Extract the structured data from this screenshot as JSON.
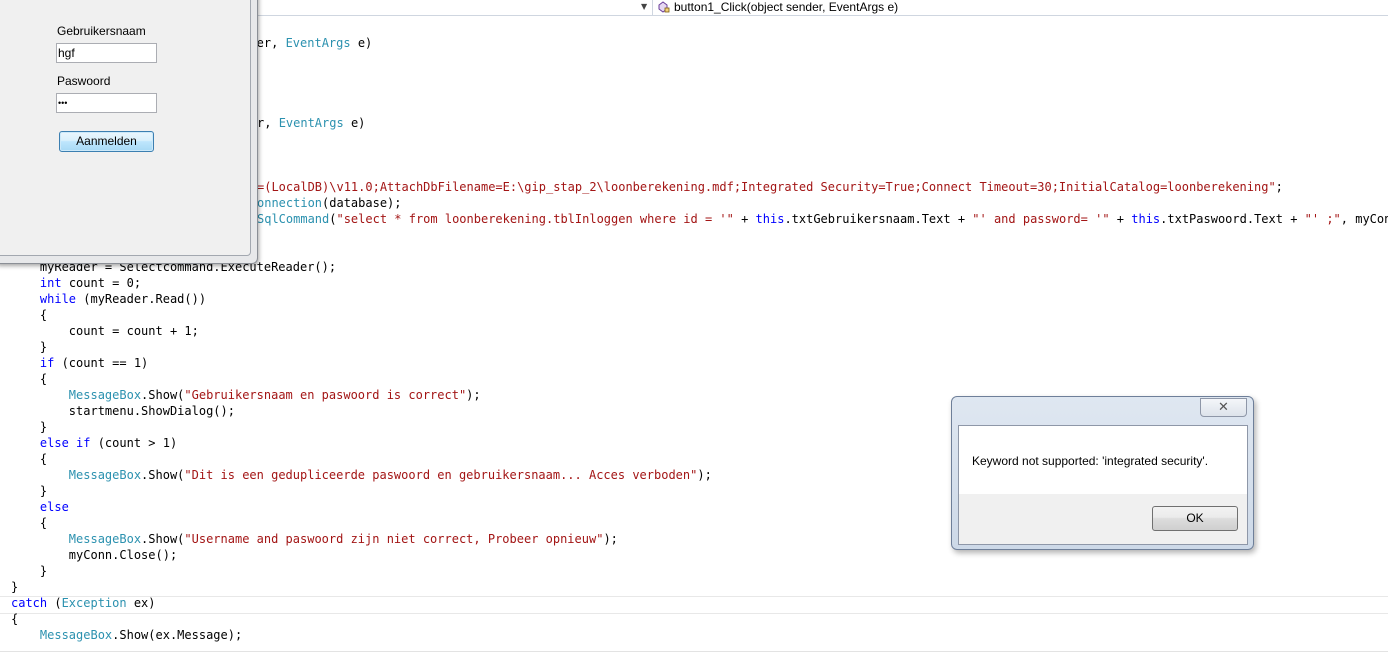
{
  "editor": {
    "member_dropdown": "button1_Click(object sender, EventArgs e)",
    "code_lines": [
      {
        "segments": [
          [
            "",
            "ender, "
          ],
          [
            "ty",
            "EventArgs"
          ],
          [
            "",
            " e)"
          ]
        ]
      },
      {
        "segments": [
          [
            "",
            "r, "
          ],
          [
            "ty",
            "EventArgs"
          ],
          [
            "",
            " e)"
          ]
        ]
      },
      {
        "segments": [
          [
            "st",
            "=(LocalDB)\\v11.0;AttachDbFilename=E:\\gip_stap_2\\loonberekening.mdf;Integrated Security=True;Connect Timeout=30;InitialCatalog=loonberekening\""
          ],
          [
            "",
            ";"
          ]
        ]
      },
      {
        "segments": [
          [
            "ty",
            "onnection"
          ],
          [
            "",
            "(database);"
          ]
        ]
      },
      {
        "segments": [
          [
            "ty",
            "SqlCommand"
          ],
          [
            "",
            "("
          ],
          [
            "st",
            "\"select * from loonberekening.tblInloggen where id = '\""
          ],
          [
            "",
            " + "
          ],
          [
            "kw",
            "this"
          ],
          [
            "",
            ".txtGebruikersnaam.Text + "
          ],
          [
            "st",
            "\"' and password= '\""
          ],
          [
            "",
            " + "
          ],
          [
            "kw",
            "this"
          ],
          [
            "",
            ".txtPaswoord.Text + "
          ],
          [
            "st",
            "\"' ;\""
          ],
          [
            "",
            ", myConn);"
          ]
        ]
      },
      {
        "segments": [
          [
            "",
            "    myReader = Selectcommand.ExecuteReader();"
          ]
        ]
      },
      {
        "segments": [
          [
            "",
            "    "
          ],
          [
            "kw",
            "int"
          ],
          [
            "",
            " count = 0;"
          ]
        ]
      },
      {
        "segments": [
          [
            "",
            "    "
          ],
          [
            "kw",
            "while"
          ],
          [
            "",
            " (myReader.Read())"
          ]
        ]
      },
      {
        "segments": [
          [
            "",
            "    {"
          ]
        ]
      },
      {
        "segments": [
          [
            "",
            "        count = count + 1;"
          ]
        ]
      },
      {
        "segments": [
          [
            "",
            "    }"
          ]
        ]
      },
      {
        "segments": [
          [
            "",
            "    "
          ],
          [
            "kw",
            "if"
          ],
          [
            "",
            " (count == 1)"
          ]
        ]
      },
      {
        "segments": [
          [
            "",
            "    {"
          ]
        ]
      },
      {
        "segments": [
          [
            "",
            "        "
          ],
          [
            "ty",
            "MessageBox"
          ],
          [
            "",
            ".Show("
          ],
          [
            "st",
            "\"Gebruikersnaam en paswoord is correct\""
          ],
          [
            "",
            ");"
          ]
        ]
      },
      {
        "segments": [
          [
            "",
            "        startmenu.ShowDialog();"
          ]
        ]
      },
      {
        "segments": [
          [
            "",
            "    }"
          ]
        ]
      },
      {
        "segments": [
          [
            "",
            "    "
          ],
          [
            "kw",
            "else if"
          ],
          [
            "",
            " (count > 1)"
          ]
        ]
      },
      {
        "segments": [
          [
            "",
            "    {"
          ]
        ]
      },
      {
        "segments": [
          [
            "",
            "        "
          ],
          [
            "ty",
            "MessageBox"
          ],
          [
            "",
            ".Show("
          ],
          [
            "st",
            "\"Dit is een gedupliceerde paswoord en gebruikersnaam... Acces verboden\""
          ],
          [
            "",
            ");"
          ]
        ]
      },
      {
        "segments": [
          [
            "",
            "    }"
          ]
        ]
      },
      {
        "segments": [
          [
            "",
            "    "
          ],
          [
            "kw",
            "else"
          ]
        ]
      },
      {
        "segments": [
          [
            "",
            "    {"
          ]
        ]
      },
      {
        "segments": [
          [
            "",
            "        "
          ],
          [
            "ty",
            "MessageBox"
          ],
          [
            "",
            ".Show("
          ],
          [
            "st",
            "\"Username and paswoord zijn niet correct, Probeer opnieuw\""
          ],
          [
            "",
            ");"
          ]
        ]
      },
      {
        "segments": [
          [
            "",
            "        myConn.Close();"
          ]
        ]
      },
      {
        "segments": [
          [
            "",
            "    }"
          ]
        ]
      },
      {
        "segments": [
          [
            "",
            "}"
          ]
        ]
      },
      {
        "segments": [
          [
            "kw",
            "catch"
          ],
          [
            "",
            " ("
          ],
          [
            "ty",
            "Exception"
          ],
          [
            "",
            " ex)"
          ]
        ]
      },
      {
        "segments": [
          [
            "",
            "{"
          ]
        ]
      },
      {
        "segments": [
          [
            "",
            "    "
          ],
          [
            "ty",
            "MessageBox"
          ],
          [
            "",
            ".Show(ex.Message);"
          ]
        ]
      }
    ]
  },
  "login_form": {
    "username_label": "Gebruikersnaam",
    "username_value": "hgf",
    "password_label": "Paswoord",
    "password_value": "•••",
    "login_button": "Aanmelden"
  },
  "message_box": {
    "message": "Keyword not supported: 'integrated security'.",
    "ok_button": "OK",
    "close_glyph": "✕"
  },
  "colors": {
    "keyword": "#0000ff",
    "type": "#2b91af",
    "string": "#a31515"
  }
}
